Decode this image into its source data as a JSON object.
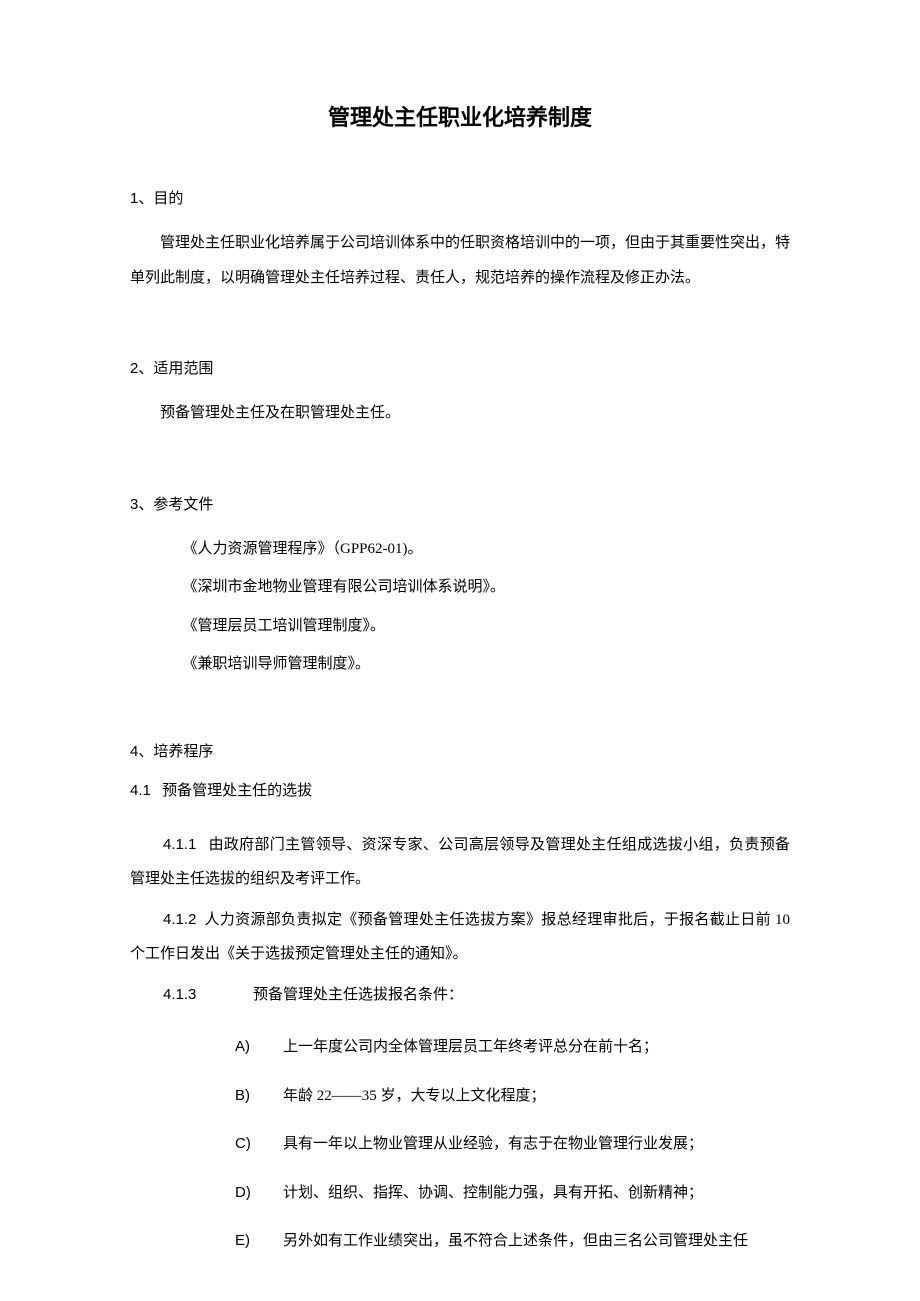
{
  "title": "管理处主任职业化培养制度",
  "sections": {
    "s1": {
      "num": "1、",
      "heading": "目的",
      "paragraph": "管理处主任职业化培养属于公司培训体系中的任职资格培训中的一项，但由于其重要性突出，特单列此制度，以明确管理处主任培养过程、责任人，规范培养的操作流程及修正办法。"
    },
    "s2": {
      "num": "2、",
      "heading": "适用范围",
      "paragraph": "预备管理处主任及在职管理处主任。"
    },
    "s3": {
      "num": "3、",
      "heading": "参考文件",
      "refs": [
        "《人力资源管理程序》（GPP62-01)。",
        "《深圳市金地物业管理有限公司培训体系说明》。",
        "《管理层员工培训管理制度》。",
        "《兼职培训导师管理制度》。"
      ]
    },
    "s4": {
      "num": "4、",
      "heading": "培养程序",
      "sub41": {
        "num": "4.1",
        "heading": "预备管理处主任的选拔",
        "items": {
          "i411": {
            "num": "4.1.1",
            "text": "由政府部门主管领导、资深专家、公司高层领导及管理处主任组成选拔小组，负责预备管理处主任选拔的组织及考评工作。"
          },
          "i412": {
            "num": "4.1.2",
            "text": "人力资源部负责拟定《预备管理处主任选拔方案》报总经理审批后，于报名截止日前 10 个工作日发出《关于选拔预定管理处主任的通知》。"
          },
          "i413": {
            "num": "4.1.3",
            "text": "预备管理处主任选拔报名条件：",
            "list": [
              {
                "marker": "A)",
                "text": "上一年度公司内全体管理层员工年终考评总分在前十名；"
              },
              {
                "marker": "B)",
                "text": "年龄 22——35 岁，大专以上文化程度；"
              },
              {
                "marker": "C)",
                "text": "具有一年以上物业管理从业经验，有志于在物业管理行业发展；"
              },
              {
                "marker": "D)",
                "text": "计划、组织、指挥、协调、控制能力强，具有开拓、创新精神；"
              },
              {
                "marker": "E)",
                "text": "另外如有工作业绩突出，虽不符合上述条件，但由三名公司管理处主任"
              }
            ]
          }
        }
      }
    }
  }
}
